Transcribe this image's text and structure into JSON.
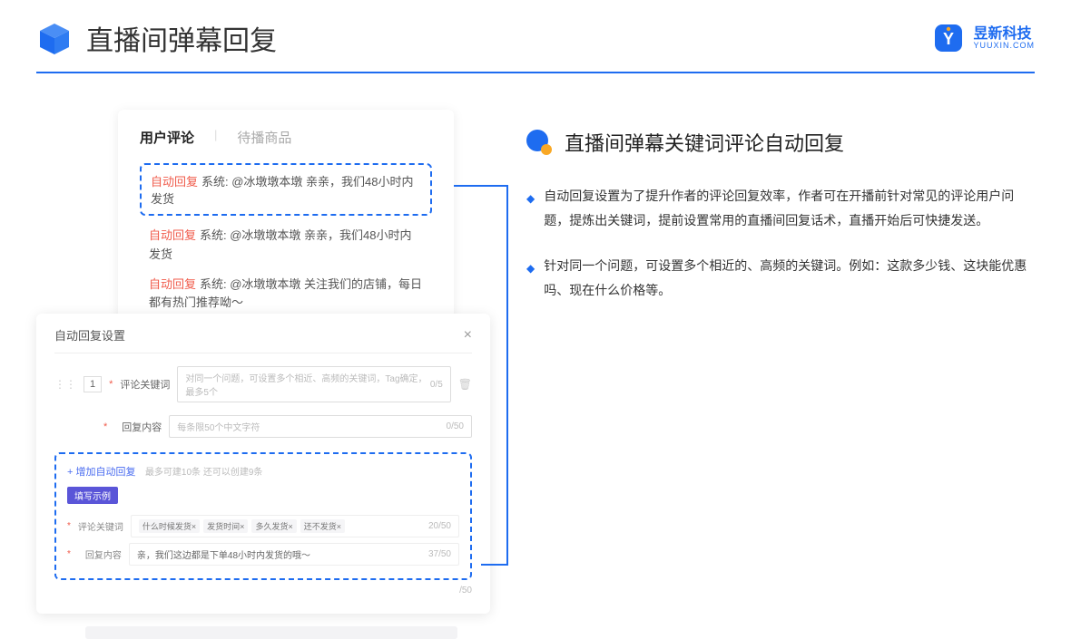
{
  "header": {
    "title": "直播间弹幕回复",
    "brand_cn": "昱新科技",
    "brand_en": "YUUXIN.COM"
  },
  "card1": {
    "tab_active": "用户评论",
    "tab_inactive": "待播商品",
    "auto_label": "自动回复",
    "row1": "系统: @冰墩墩本墩 亲亲，我们48小时内发货",
    "row2": "系统: @冰墩墩本墩 亲亲，我们48小时内发货",
    "row3": "系统: @冰墩墩本墩 关注我们的店铺，每日都有热门推荐呦～"
  },
  "card2": {
    "modal_title": "自动回复设置",
    "index": "1",
    "label_keyword": "评论关键词",
    "placeholder_keyword": "对同一个问题，可设置多个相近、高频的关键词，Tag确定，最多5个",
    "counter_keyword": "0/5",
    "label_content": "回复内容",
    "placeholder_content": "每条限50个中文字符",
    "counter_content": "0/50",
    "add_link": "+ 增加自动回复",
    "add_hint": "最多可建10条 还可以创建9条",
    "example_label": "填写示例",
    "ex_keyword_label": "评论关键词",
    "tags": [
      "什么时候发货×",
      "发货时间×",
      "多久发货×",
      "还不发货×"
    ],
    "tags_counter": "20/50",
    "ex_content_label": "回复内容",
    "ex_content_value": "亲，我们这边都是下单48小时内发货的哦～",
    "ex_content_counter": "37/50",
    "bottom_counter": "/50"
  },
  "right": {
    "section_title": "直播间弹幕关键词评论自动回复",
    "bullet1": "自动回复设置为了提升作者的评论回复效率，作者可在开播前针对常见的评论用户问题，提炼出关键词，提前设置常用的直播间回复话术，直播开始后可快捷发送。",
    "bullet2": "针对同一个问题，可设置多个相近的、高频的关键词。例如：这款多少钱、这块能优惠吗、现在什么价格等。"
  }
}
